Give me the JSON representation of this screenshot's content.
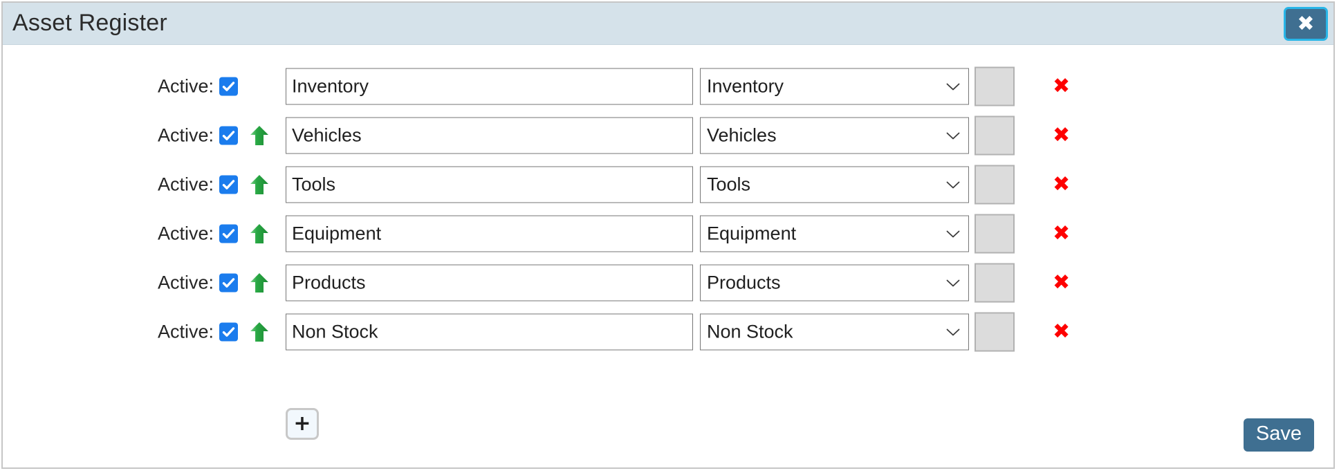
{
  "window": {
    "title": "Asset Register",
    "close_label": "✖"
  },
  "colors": {
    "header_bg": "#d5e2ea",
    "accent_button": "#3f6f91",
    "focus_ring": "#29b6e8",
    "checkbox": "#1b7ced",
    "move_up_arrow": "#22a03c",
    "delete_icon": "#fe0000",
    "color_swatch": "#dcdcdc"
  },
  "form": {
    "active_label": "Active:",
    "add_label": "+",
    "delete_label": "✖",
    "save_label": "Save",
    "rows": [
      {
        "active": true,
        "has_move_up": false,
        "name": "Inventory",
        "type": "Inventory",
        "color": "",
        "delete": "✖"
      },
      {
        "active": true,
        "has_move_up": true,
        "name": "Vehicles",
        "type": "Vehicles",
        "color": "",
        "delete": "✖"
      },
      {
        "active": true,
        "has_move_up": true,
        "name": "Tools",
        "type": "Tools",
        "color": "",
        "delete": "✖"
      },
      {
        "active": true,
        "has_move_up": true,
        "name": "Equipment",
        "type": "Equipment",
        "color": "",
        "delete": "✖"
      },
      {
        "active": true,
        "has_move_up": true,
        "name": "Products",
        "type": "Products",
        "color": "",
        "delete": "✖"
      },
      {
        "active": true,
        "has_move_up": true,
        "name": "Non Stock",
        "type": "Non Stock",
        "color": "",
        "delete": "✖"
      }
    ]
  }
}
